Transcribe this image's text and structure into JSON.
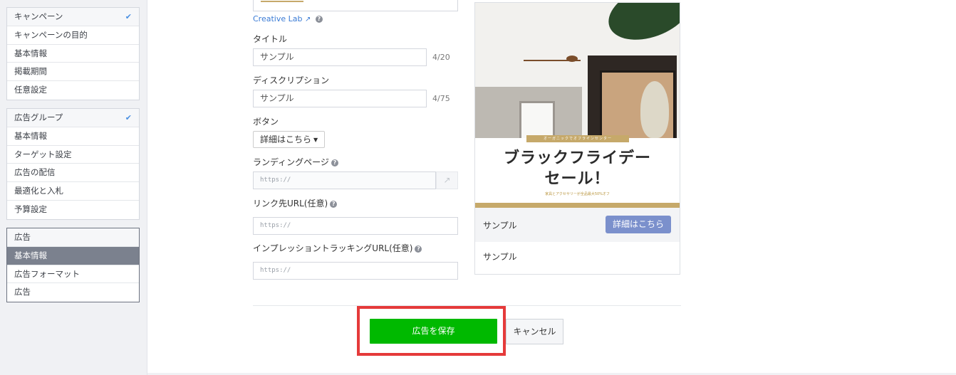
{
  "sidebar": {
    "campaign": {
      "header": "キャンペーン",
      "items": [
        "キャンペーンの目的",
        "基本情報",
        "掲載期間",
        "任意設定"
      ]
    },
    "adgroup": {
      "header": "広告グループ",
      "items": [
        "基本情報",
        "ターゲット設定",
        "広告の配信",
        "最適化と入札",
        "予算設定"
      ]
    },
    "ad": {
      "header": "広告",
      "items": [
        "基本情報",
        "広告フォーマット",
        "広告"
      ]
    }
  },
  "form": {
    "creative_lab": "Creative Lab",
    "title_label": "タイトル",
    "title_value": "サンプル",
    "title_counter": "4/20",
    "description_label": "ディスクリプション",
    "description_value": "サンプル",
    "description_counter": "4/75",
    "button_label": "ボタン",
    "button_value": "詳細はこちら",
    "landing_label": "ランディングページ",
    "landing_placeholder": "https://",
    "link_label": "リンク先URL(任意)",
    "link_placeholder": "https://",
    "impression_label": "インプレッショントラッキングURL(任意)",
    "impression_placeholder": "https://"
  },
  "preview": {
    "ribbon": "オーガニックでオフラインセンター",
    "headline_1": "ブラックフライデー",
    "headline_2": "セール！",
    "subline": "家具とアクセサリーが全品最大50%オフ",
    "title": "サンプル",
    "cta": "詳細はこちら",
    "description": "サンプル"
  },
  "footer": {
    "save": "広告を保存",
    "cancel": "キャンセル"
  },
  "colors": {
    "save_green": "#00b900",
    "highlight_red": "#e53a3a",
    "cta_blue": "#7b90cc",
    "accent_gold": "#c6a96a",
    "selected_nav": "#7b818e"
  }
}
